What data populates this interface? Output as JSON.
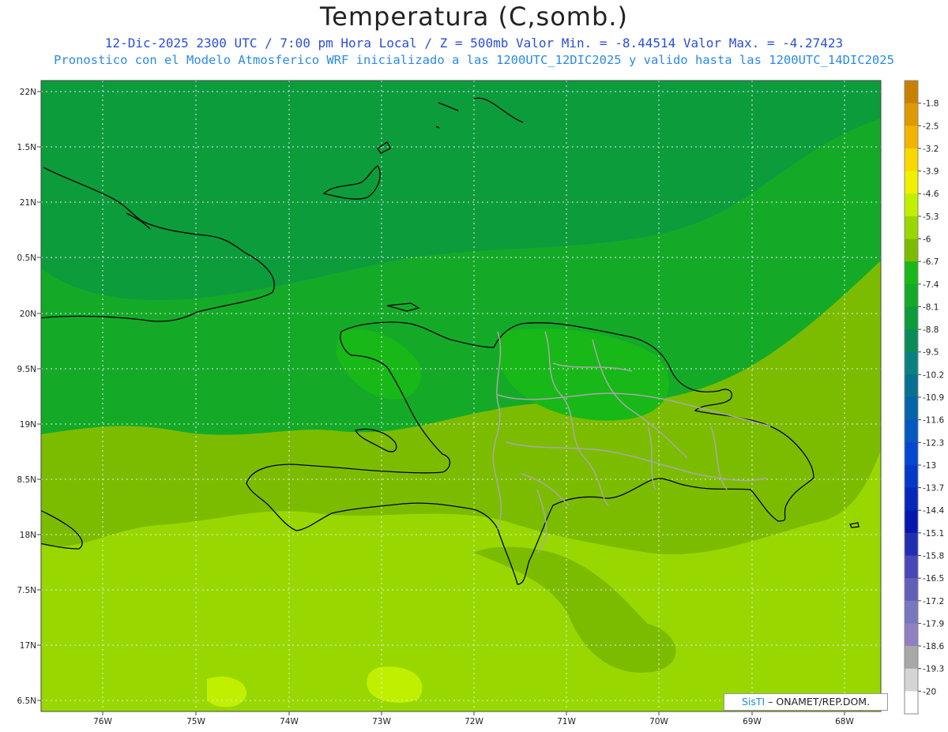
{
  "header": {
    "title": "Temperatura (C,somb.)",
    "subtitle_1": "12-Dic-2025  2300 UTC / 7:00 pm Hora Local / Z = 500mb  Valor Min. = -8.44514  Valor Max. = -4.27423",
    "subtitle_2": "Pronostico con el Modelo Atmosferico WRF inicializado a las 1200UTC_12DIC2025 y valido hasta las  1200UTC_14DIC2025"
  },
  "axes": {
    "lat_labels": [
      "22N",
      "1.5N",
      "21N",
      "0.5N",
      "20N",
      "9.5N",
      "19N",
      "8.5N",
      "18N",
      "7.5N",
      "17N",
      "6.5N"
    ],
    "lon_labels": [
      "76W",
      "75W",
      "74W",
      "73W",
      "72W",
      "71W",
      "70W",
      "69W",
      "68W"
    ]
  },
  "colorbar": {
    "labels": [
      "-1.8",
      "-2.5",
      "-3.2",
      "-3.9",
      "-4.6",
      "-5.3",
      "-6",
      "-6.7",
      "-7.4",
      "-8.1",
      "-8.8",
      "-9.5",
      "-10.2",
      "-10.9",
      "-11.6",
      "-12.3",
      "-13",
      "-13.7",
      "-14.4",
      "-15.1",
      "-15.8",
      "-16.5",
      "-17.2",
      "-17.9",
      "-18.6",
      "-19.3",
      "-20"
    ],
    "colors": [
      "#c88000",
      "#e09a00",
      "#f2b400",
      "#f8d800",
      "#f0f000",
      "#c0f000",
      "#98d800",
      "#7cbc00",
      "#18b818",
      "#14aa28",
      "#0c9c3c",
      "#0a8c58",
      "#0a8080",
      "#087090",
      "#0664a8",
      "#0458c0",
      "#0448d0",
      "#0438c8",
      "#0428b8",
      "#0418b0",
      "#2030b0",
      "#4848b8",
      "#6060b8",
      "#7878c0",
      "#9080c0",
      "#a8a8a8",
      "#d4d4d4",
      "#ffffff"
    ]
  },
  "credit": {
    "brand": "SisTI",
    "text": " – ONAMET/REP.DOM."
  }
}
